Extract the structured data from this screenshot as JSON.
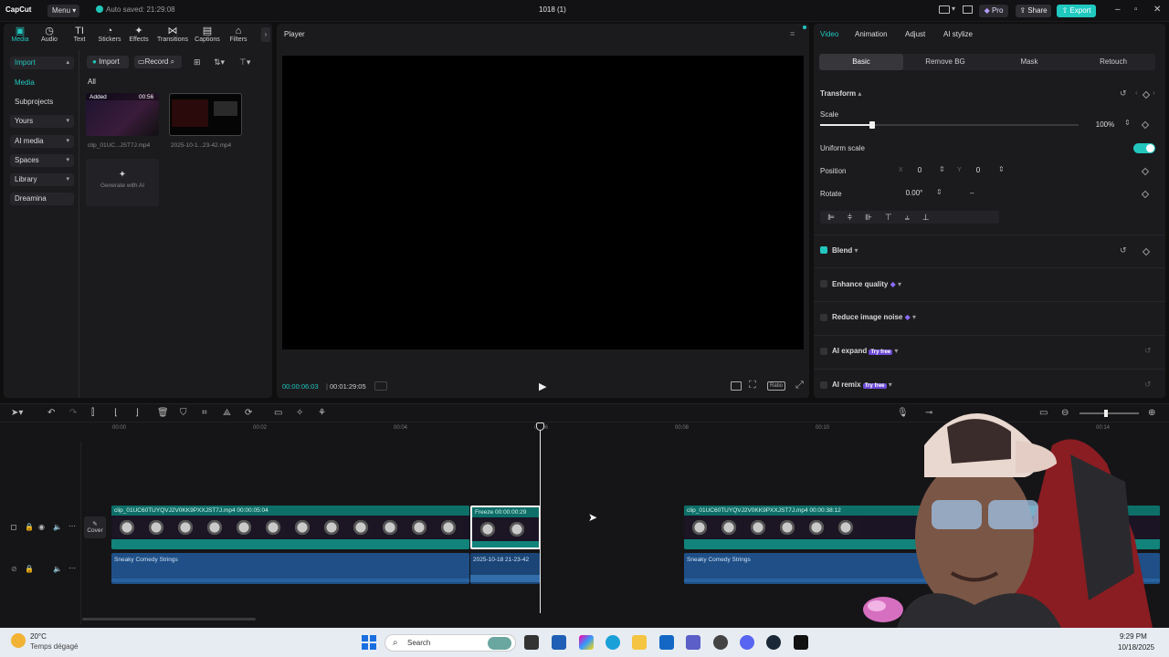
{
  "titlebar": {
    "logo": "CapCut",
    "menu_label": "Menu",
    "autosave": "Auto saved: 21:29:08",
    "project_title": "1018 (1)",
    "pro_label": "Pro",
    "share_label": "Share",
    "export_label": "Export",
    "window_minimize": "–",
    "window_maximize": "▫",
    "window_close": "✕"
  },
  "tools": [
    {
      "label": "Media",
      "icon": "▣"
    },
    {
      "label": "Audio",
      "icon": "◷"
    },
    {
      "label": "Text",
      "icon": "TI"
    },
    {
      "label": "Stickers",
      "icon": "◔"
    },
    {
      "label": "Effects",
      "icon": "✦"
    },
    {
      "label": "Transitions",
      "icon": "⋈"
    },
    {
      "label": "Captions",
      "icon": "▤"
    },
    {
      "label": "Filters",
      "icon": "⌂"
    }
  ],
  "sidebar": {
    "items": [
      {
        "label": "Import",
        "chevron": "▴"
      },
      {
        "label": "Media",
        "chevron": ""
      },
      {
        "label": "Subprojects",
        "chevron": ""
      },
      {
        "label": "Yours",
        "chevron": "▾"
      },
      {
        "label": "AI media",
        "chevron": "▾"
      },
      {
        "label": "Spaces",
        "chevron": "▾"
      },
      {
        "label": "Library",
        "chevron": "▾"
      },
      {
        "label": "Dreamina",
        "chevron": ""
      }
    ]
  },
  "media": {
    "import_label": "Import",
    "record_label": "Record",
    "filter_all": "All",
    "items": [
      {
        "name": "clip_01UC...JST7J.mp4",
        "badge": "Added",
        "duration": "00:56"
      },
      {
        "name": "2025-10-1...23-42.mp4",
        "badge": "",
        "duration": ""
      }
    ],
    "generate_label": "Generate with AI"
  },
  "player": {
    "title": "Player",
    "current_time": "00:00:06:03",
    "total_time": "00:01:29:05",
    "ratio_label": "Ratio"
  },
  "inspector": {
    "tabs": [
      "Video",
      "Animation",
      "Adjust",
      "AI stylize"
    ],
    "subtabs": [
      "Basic",
      "Remove BG",
      "Mask",
      "Retouch"
    ],
    "transform_label": "Transform",
    "scale_label": "Scale",
    "scale_value": "100%",
    "scale_level": 0.2,
    "uniform_scale_label": "Uniform scale",
    "uniform_scale_on": true,
    "position_label": "Position",
    "pos_x_label": "X",
    "pos_x": "0",
    "pos_y_label": "Y",
    "pos_y": "0",
    "rotate_label": "Rotate",
    "rotate_value": "0.00°",
    "rotate_flip": "–",
    "blend_label": "Blend",
    "enhance_label": "Enhance quality",
    "noise_label": "Reduce image noise",
    "ai_expand_label": "AI expand",
    "ai_remix_label": "AI remix",
    "try_free": "Try free"
  },
  "timeline": {
    "ruler": [
      "00:00",
      "00:02",
      "00:04",
      "00:06",
      "00:08",
      "00:10",
      "00:14"
    ],
    "cover_label": "Cover",
    "video_clips": [
      {
        "title": "clip_01UC60TUYQVJ2V0KK9PXXJST7J.mp4   00:00:05:04"
      },
      {
        "title": "Freeze   00:00:00:29"
      },
      {
        "title": "clip_01UC60TUYQVJ2V0KK9PXXJST7J.mp4   00:00:38:12"
      }
    ],
    "audio_clips": [
      {
        "title": "Sneaky Comedy Strings"
      },
      {
        "title": "2025-10-18 21-23-42"
      },
      {
        "title": "Sneaky Comedy Strings"
      }
    ]
  },
  "taskbar": {
    "temp": "20°C",
    "weather": "Temps dégagé",
    "search_placeholder": "Search",
    "time": "9:29 PM",
    "date": "10/18/2025"
  },
  "colors": {
    "accent": "#22c6bd",
    "video_clip": "#11837b",
    "audio_clip": "#1f4f86"
  }
}
